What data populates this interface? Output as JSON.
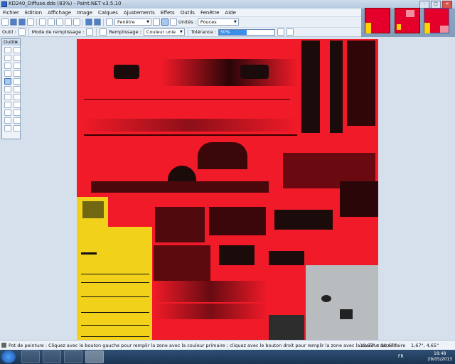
{
  "window": {
    "title": "KD240_Diffuse.dds (83%) - Paint.NET v3.5.10"
  },
  "menu": {
    "items": [
      "Fichier",
      "Edition",
      "Affichage",
      "Image",
      "Calques",
      "Ajustements",
      "Effets",
      "Outils",
      "Fenêtre",
      "Aide"
    ]
  },
  "toolbar": {
    "zoom_mode": "Fenêtre",
    "units_label": "Unités :",
    "units_value": "Pouces"
  },
  "toolbar2": {
    "tool_label": "Outil :",
    "fill_mode_label": "Mode de remplissage :",
    "fill_label": "Remplissage :",
    "fill_value": "Couleur unie",
    "tolerance_label": "Tolérance :",
    "tolerance_text": "50%",
    "tolerance_value": 0.5
  },
  "tools_window": {
    "title": "Outils",
    "close_glyph": "×"
  },
  "status": {
    "message": "Pot de peinture : Cliquez avec le bouton gauche pour remplir la zone avec la couleur primaire ; cliquez avec le bouton droit pour remplir la zone avec la couleur secondaire",
    "size": "10,67\" x 10,67\"",
    "position": "1,67\", 4,65\""
  },
  "taskbar": {
    "lang": "FR",
    "time": "18:48",
    "date": "29/05/2013"
  },
  "colors": {
    "texture_red": "#f01a28",
    "texture_yellow": "#f2d11b",
    "texture_grey": "#b8bcbf",
    "accent_blue": "#3d8ee9"
  }
}
